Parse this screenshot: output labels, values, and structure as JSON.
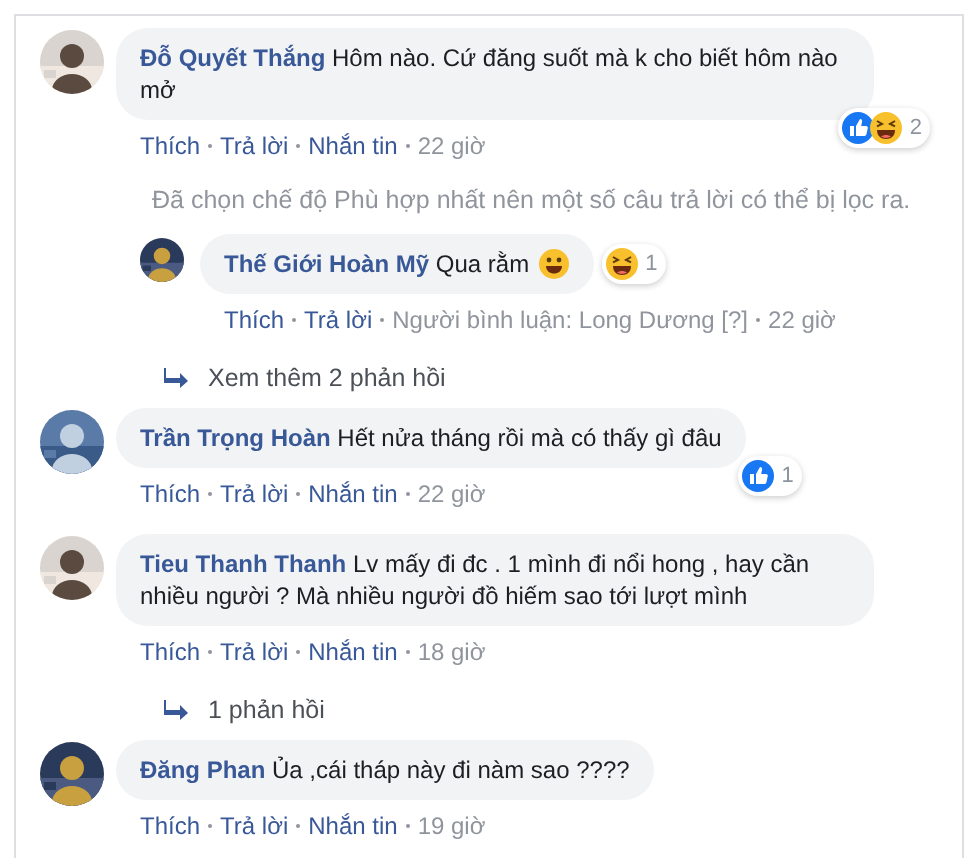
{
  "comments": [
    {
      "kind": "comment",
      "name": "Đỗ Quyết Thắng",
      "text": "Hôm nào. Cứ đăng suốt mà k cho biết hôm nào mở",
      "actions": [
        "Thích",
        "Trả lời",
        "Nhắn tin"
      ],
      "time": "22 giờ",
      "reactions": {
        "like": true,
        "haha": true,
        "count": "2"
      }
    },
    {
      "kind": "notice",
      "text": "Đã chọn chế độ Phù hợp nhất nên một số câu trả lời có thể bị lọc ra."
    },
    {
      "kind": "reply",
      "name": "Thế Giới Hoàn Mỹ",
      "text": "Qua rằm",
      "smiley": true,
      "actions": [
        "Thích",
        "Trả lời"
      ],
      "note": "Người bình luận: Long Dương [?]",
      "time": "22 giờ",
      "reactions": {
        "like": false,
        "haha": true,
        "count": "1"
      }
    },
    {
      "kind": "more",
      "text": "Xem thêm 2 phản hồi"
    },
    {
      "kind": "comment",
      "name": "Trần Trọng Hoàn",
      "text": "Hết nửa tháng rồi mà có thấy gì đâu",
      "actions": [
        "Thích",
        "Trả lời",
        "Nhắn tin"
      ],
      "time": "22 giờ",
      "reactions": {
        "like": true,
        "haha": false,
        "count": "1"
      }
    },
    {
      "kind": "comment",
      "name": "Tieu Thanh Thanh",
      "text": "Lv mấy đi đc . 1 mình đi nổi hong , hay cần nhiều người ? Mà nhiều người đồ hiếm sao tới lượt mình",
      "actions": [
        "Thích",
        "Trả lời",
        "Nhắn tin"
      ],
      "time": "18 giờ"
    },
    {
      "kind": "more",
      "text": "1 phản hồi"
    },
    {
      "kind": "comment",
      "name": "Đăng Phan",
      "text": "Ủa ,cái tháp này đi nàm sao ????",
      "actions": [
        "Thích",
        "Trả lời",
        "Nhắn tin"
      ],
      "time": "19 giờ"
    }
  ]
}
